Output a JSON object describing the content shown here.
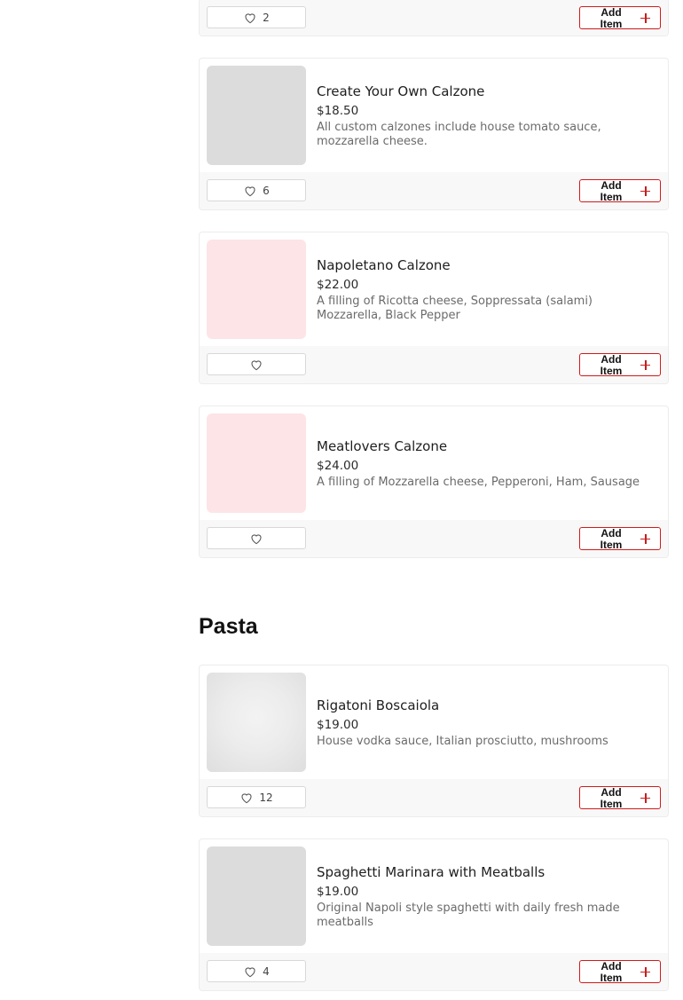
{
  "add_label": "Add Item",
  "top_card": {
    "likes": "2"
  },
  "calzones": [
    {
      "name": "Create Your Own Calzone",
      "price": "$18.50",
      "description": "All custom calzones include house tomato sauce, mozzarella cheese.",
      "likes": "6",
      "image": "placeholder-grey"
    },
    {
      "name": "Napoletano Calzone",
      "price": "$22.00",
      "description": "A filling of Ricotta cheese, Soppressata (salami) Mozzarella, Black Pepper",
      "likes": "",
      "image": "placeholder-pink"
    },
    {
      "name": "Meatlovers Calzone",
      "price": "$24.00",
      "description": "A filling of Mozzarella cheese, Pepperoni, Ham, Sausage",
      "likes": "",
      "image": "placeholder-pink"
    }
  ],
  "pasta_section": {
    "title": "Pasta",
    "items": [
      {
        "name": "Rigatoni Boscaiola",
        "price": "$19.00",
        "description": "House vodka sauce, Italian prosciutto, mushrooms",
        "likes": "12",
        "image": "photo"
      },
      {
        "name": "Spaghetti Marinara with Meatballs",
        "price": "$19.00",
        "description": "Original Napoli style spaghetti with daily fresh made meatballs",
        "likes": "4",
        "image": "placeholder-grey"
      }
    ]
  },
  "colors": {
    "accent": "#d11a1a",
    "placeholder_pink": "#fde4e6",
    "placeholder_grey": "#dcdcdc"
  }
}
